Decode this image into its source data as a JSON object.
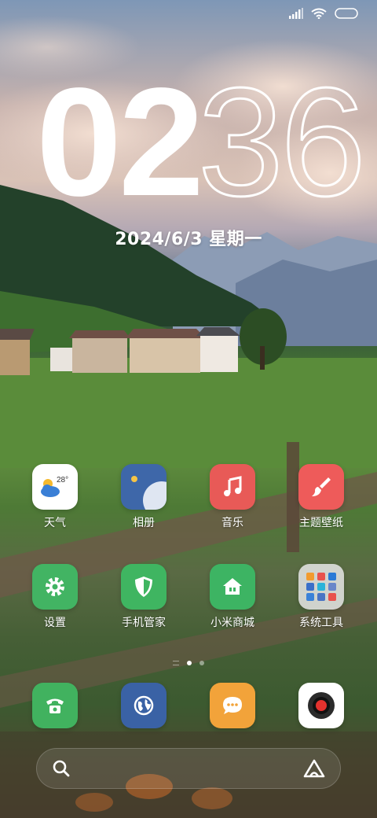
{
  "clock": {
    "hours": "02",
    "minutes": "36"
  },
  "date": "2024/6/3 星期一",
  "apps": [
    {
      "label": "天气",
      "icon": "weather-icon",
      "temp": "28°"
    },
    {
      "label": "相册",
      "icon": "gallery-icon"
    },
    {
      "label": "音乐",
      "icon": "music-icon"
    },
    {
      "label": "主题壁纸",
      "icon": "themes-icon"
    },
    {
      "label": "设置",
      "icon": "settings-gear-icon"
    },
    {
      "label": "手机管家",
      "icon": "security-shield-icon"
    },
    {
      "label": "小米商城",
      "icon": "mi-store-house-icon"
    },
    {
      "label": "系统工具",
      "icon": "system-tools-folder-icon"
    }
  ],
  "dock": [
    {
      "icon": "phone-icon"
    },
    {
      "icon": "browser-globe-icon"
    },
    {
      "icon": "messages-icon"
    },
    {
      "icon": "camera-icon"
    }
  ],
  "colors": {
    "weather_bg": "#ffffff",
    "gallery_bg": "#3e67a9",
    "music_bg": "#e85a57",
    "themes_bg": "#ee5b5a",
    "settings_bg": "#42b463",
    "security_bg": "#3fb561",
    "store_bg": "#3db463",
    "phone_bg": "#41b25f",
    "browser_bg": "#3a62a5",
    "messages_bg": "#f2a33a",
    "camera_bg": "#ffffff"
  },
  "page_indicator": {
    "pages": 2,
    "current": 1
  }
}
